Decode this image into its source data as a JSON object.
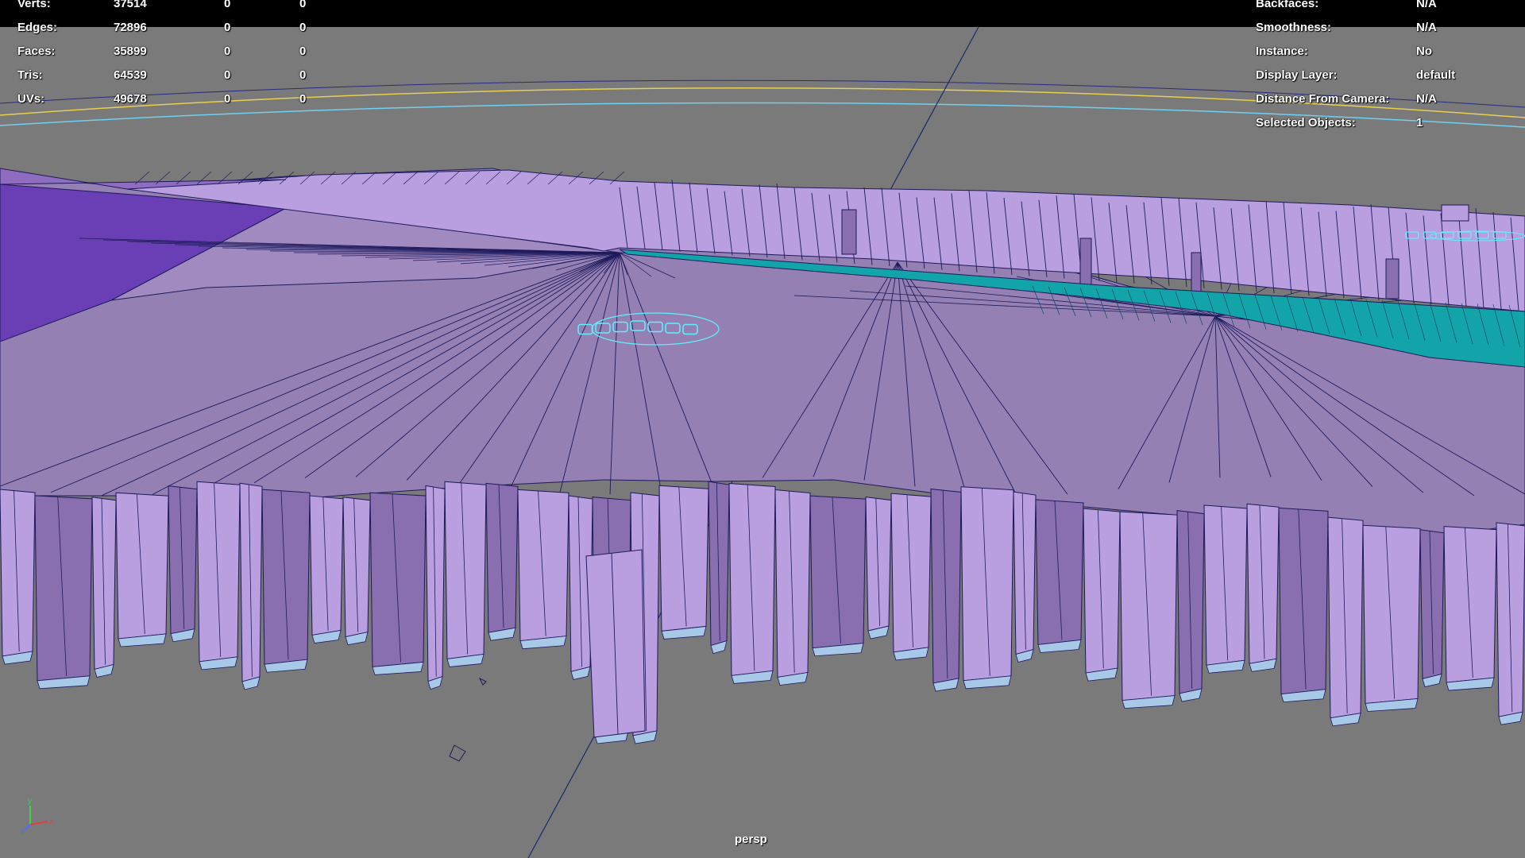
{
  "viewport": {
    "camera": "persp",
    "colors": {
      "background": "#7a7a7a",
      "top_face": "#9580b3",
      "wall_face": "#b99fe0",
      "wall_dark_face": "#8a6fb0",
      "violet_face": "#6a3fb5",
      "teal_face": "#12a4a8",
      "wire": "#1e1a5c",
      "selection": "#5ff0ff",
      "horizon_yellow": "#e8d050",
      "horizon_cyan": "#6fd0f0"
    }
  },
  "stats": {
    "rows": [
      {
        "label": "Verts:",
        "v1": "37514",
        "v2": "0",
        "v3": "0"
      },
      {
        "label": "Edges:",
        "v1": "72896",
        "v2": "0",
        "v3": "0"
      },
      {
        "label": "Faces:",
        "v1": "35899",
        "v2": "0",
        "v3": "0"
      },
      {
        "label": "Tris:",
        "v1": "64539",
        "v2": "0",
        "v3": "0"
      },
      {
        "label": "UVs:",
        "v1": "49678",
        "v2": "0",
        "v3": "0"
      }
    ]
  },
  "object_info": {
    "rows": [
      {
        "label": "Backfaces:",
        "value": "N/A"
      },
      {
        "label": "Smoothness:",
        "value": "N/A"
      },
      {
        "label": "Instance:",
        "value": "No"
      },
      {
        "label": "Display Layer:",
        "value": "default"
      },
      {
        "label": "Distance From Camera:",
        "value": "N/A"
      },
      {
        "label": "Selected Objects:",
        "value": "1"
      }
    ]
  },
  "axis": {
    "y": "y",
    "z": "z",
    "x": "x",
    "icon": "axis-gizmo-icon"
  }
}
